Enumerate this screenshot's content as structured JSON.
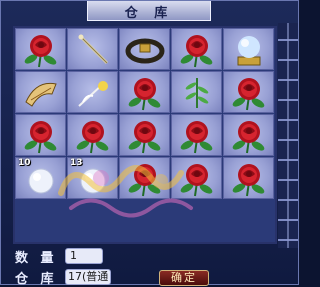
{
  "window": {
    "title": "仓 库"
  },
  "colors": {
    "rose": "#c01a24",
    "leaf": "#1f7a2a",
    "slot": "#98a0d4",
    "frame": "#1d2a5a",
    "button": "#6a1a16"
  },
  "items": [
    {
      "icon": "rose-icon"
    },
    {
      "icon": "staff-icon"
    },
    {
      "icon": "belt-icon"
    },
    {
      "icon": "rose-icon"
    },
    {
      "icon": "crystal-ball-icon"
    },
    {
      "icon": "golden-horn-icon"
    },
    {
      "icon": "bird-feather-icon"
    },
    {
      "icon": "rose-icon"
    },
    {
      "icon": "herb-icon"
    },
    {
      "icon": "rose-icon"
    },
    {
      "icon": "rose-icon"
    },
    {
      "icon": "rose-icon"
    },
    {
      "icon": "rose-icon"
    },
    {
      "icon": "rose-icon"
    },
    {
      "icon": "rose-icon"
    },
    {
      "icon": "pearl-icon",
      "count": "10"
    },
    {
      "icon": "pearl-icon",
      "count": "13"
    },
    {
      "icon": "rose-icon"
    },
    {
      "icon": "rose-icon"
    },
    {
      "icon": "rose-icon"
    }
  ],
  "form": {
    "quantity_label": "数 量",
    "quantity_value": "1",
    "warehouse_label": "仓 库",
    "warehouse_value": "17(普通",
    "confirm_label": "确定"
  }
}
